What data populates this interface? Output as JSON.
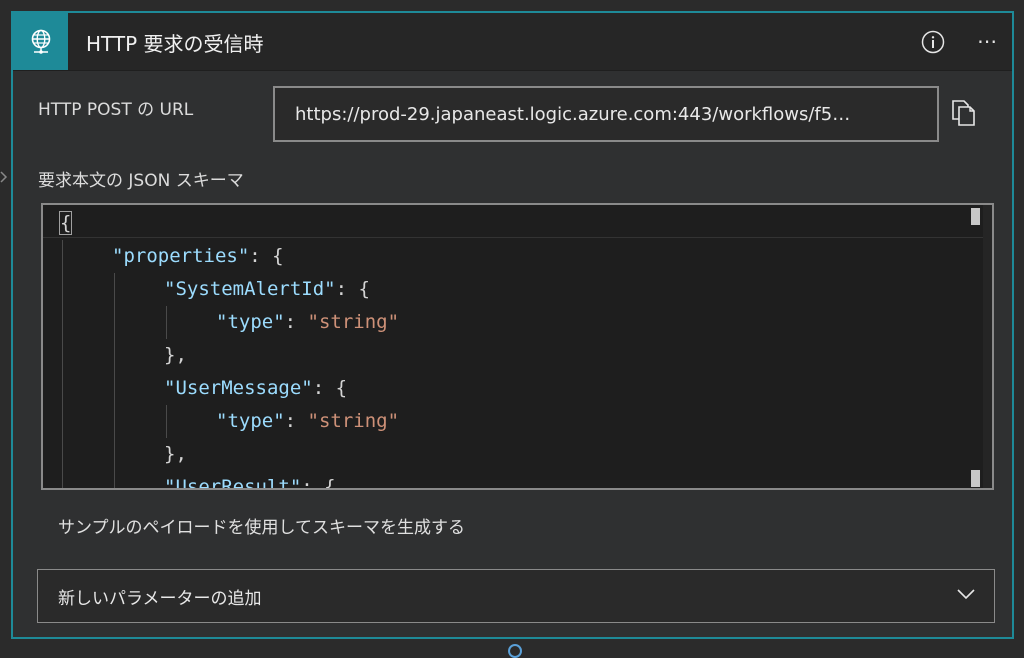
{
  "header": {
    "title": "HTTP 要求の受信時",
    "icon": "globe-network-icon",
    "more_label": "⋯"
  },
  "url_field": {
    "label": "HTTP POST の URL",
    "value": "https://prod-29.japaneast.logic.azure.com:443/workflows/f5…"
  },
  "schema": {
    "label": "要求本文の JSON スキーマ",
    "lines": [
      {
        "indent": 0,
        "tokens": [
          {
            "t": "{",
            "c": "punct"
          }
        ]
      },
      {
        "indent": 1,
        "tokens": [
          {
            "t": "\"properties\"",
            "c": "key"
          },
          {
            "t": ": {",
            "c": "punct"
          }
        ]
      },
      {
        "indent": 2,
        "tokens": [
          {
            "t": "\"SystemAlertId\"",
            "c": "key"
          },
          {
            "t": ": {",
            "c": "punct"
          }
        ]
      },
      {
        "indent": 3,
        "tokens": [
          {
            "t": "\"type\"",
            "c": "key"
          },
          {
            "t": ": ",
            "c": "punct"
          },
          {
            "t": "\"string\"",
            "c": "str"
          }
        ]
      },
      {
        "indent": 2,
        "tokens": [
          {
            "t": "},",
            "c": "punct"
          }
        ]
      },
      {
        "indent": 2,
        "tokens": [
          {
            "t": "\"UserMessage\"",
            "c": "key"
          },
          {
            "t": ": {",
            "c": "punct"
          }
        ]
      },
      {
        "indent": 3,
        "tokens": [
          {
            "t": "\"type\"",
            "c": "key"
          },
          {
            "t": ": ",
            "c": "punct"
          },
          {
            "t": "\"string\"",
            "c": "str"
          }
        ]
      },
      {
        "indent": 2,
        "tokens": [
          {
            "t": "},",
            "c": "punct"
          }
        ]
      },
      {
        "indent": 2,
        "tokens": [
          {
            "t": "\"UserResult\"",
            "c": "key"
          },
          {
            "t": ": {",
            "c": "punct"
          }
        ]
      }
    ]
  },
  "sample_link": "サンプルのペイロードを使用してスキーマを生成する",
  "add_parameter": {
    "label": "新しいパラメーターの追加"
  },
  "colors": {
    "accent": "#1e8a98",
    "key": "#9cdcfe",
    "string": "#ce9178"
  }
}
